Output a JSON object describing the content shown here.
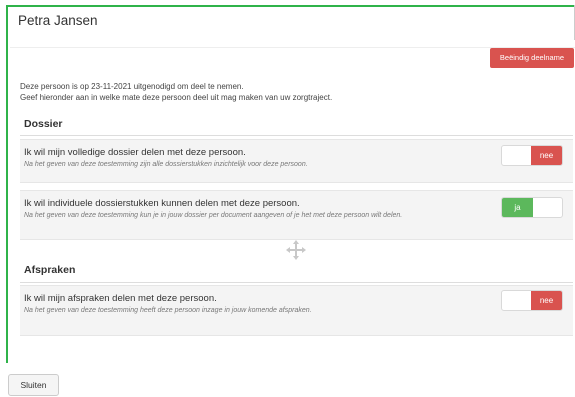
{
  "dialog": {
    "title": "Petra Jansen",
    "end_button_label": "Beëindig deelname",
    "intro_line1": "Deze persoon is op 23-11-2021 uitgenodigd om deel te nemen.",
    "intro_line2": "Geef hieronder aan in welke mate deze persoon deel uit mag maken van uw zorgtraject."
  },
  "sections": [
    {
      "title": "Dossier",
      "items": [
        {
          "title": "Ik wil mijn volledige dossier delen met deze persoon.",
          "description": "Na het geven van deze toestemming zijn alle dossierstukken inzichtelijk voor deze persoon.",
          "toggle_label": "nee",
          "toggle_state": "nee"
        },
        {
          "title": "Ik wil individuele dossierstukken kunnen delen met deze persoon.",
          "description": "Na het geven van deze toestemming kun je in jouw dossier per document aangeven of je het met deze persoon wilt delen.",
          "toggle_label": "ja",
          "toggle_state": "ja"
        }
      ]
    },
    {
      "title": "Afspraken",
      "items": [
        {
          "title": "Ik wil mijn afspraken delen met deze persoon.",
          "description": "Na het geven van deze toestemming heeft deze persoon inzage in jouw komende afspraken.",
          "toggle_label": "nee",
          "toggle_state": "nee"
        }
      ]
    }
  ],
  "footer": {
    "close_label": "Sluiten"
  },
  "colors": {
    "accent_border": "#2fb34a",
    "danger": "#d9534f",
    "success": "#5cb85c"
  }
}
